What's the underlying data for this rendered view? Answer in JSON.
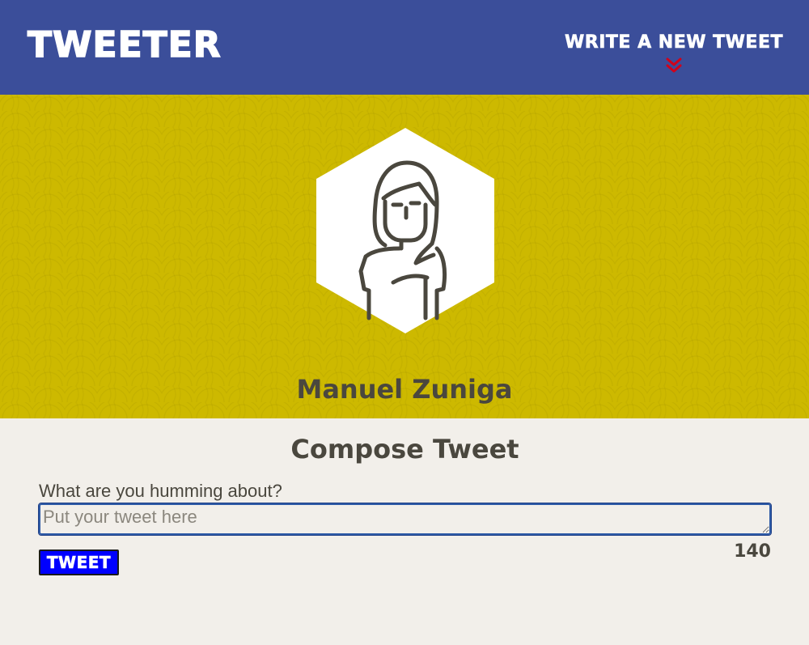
{
  "header": {
    "brand": "Tweeter",
    "compose_link": "Write a new tweet",
    "compose_link_icon": "double-chevron-down-icon"
  },
  "profile": {
    "avatar_icon": "woman-avatar-icon",
    "name": "Manuel Zuniga"
  },
  "composer": {
    "title": "Compose Tweet",
    "label": "What are you humming about?",
    "placeholder": "Put your tweet here",
    "value": "",
    "submit_label": "Tweet",
    "char_counter": "140"
  },
  "colors": {
    "nav_bg": "#3b4e9a",
    "hero_bg": "#cdb900",
    "page_bg": "#f2efea",
    "text": "#4a473e",
    "button_bg": "#0000ff",
    "chevron": "#d0021b"
  }
}
